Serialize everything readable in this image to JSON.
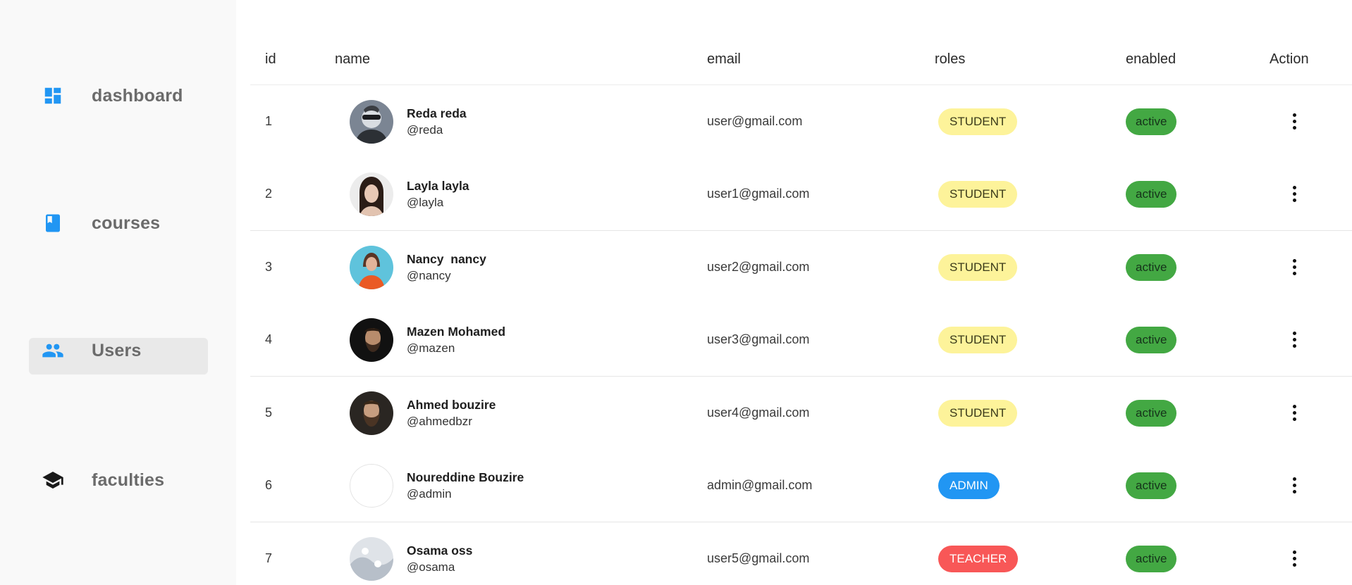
{
  "sidebar": {
    "items": [
      {
        "label": "dashboard",
        "icon": "dashboard-icon",
        "active": false
      },
      {
        "label": "courses",
        "icon": "book-icon",
        "active": false
      },
      {
        "label": "Users",
        "icon": "people-icon",
        "active": true
      },
      {
        "label": "faculties",
        "icon": "graduation-cap-icon",
        "active": false
      }
    ]
  },
  "table": {
    "headers": {
      "id": "id",
      "name": "name",
      "email": "email",
      "roles": "roles",
      "enabled": "enabled",
      "action": "Action"
    },
    "rows": [
      {
        "id": "1",
        "full_name": "Reda reda",
        "handle": "@reda",
        "email": "user@gmail.com",
        "role": "STUDENT",
        "status": "active",
        "avatar": "avatar-sunglasses-man"
      },
      {
        "id": "2",
        "full_name": "Layla layla",
        "handle": "@layla",
        "email": "user1@gmail.com",
        "role": "STUDENT",
        "status": "active",
        "avatar": "avatar-woman-dark-hair"
      },
      {
        "id": "3",
        "full_name": "Nancy  nancy",
        "handle": "@nancy",
        "email": "user2@gmail.com",
        "role": "STUDENT",
        "status": "active",
        "avatar": "avatar-woman-orange-shirt"
      },
      {
        "id": "4",
        "full_name": "Mazen Mohamed",
        "handle": "@mazen",
        "email": "user3@gmail.com",
        "role": "STUDENT",
        "status": "active",
        "avatar": "avatar-bearded-man"
      },
      {
        "id": "5",
        "full_name": "Ahmed bouzire",
        "handle": "@ahmedbzr",
        "email": "user4@gmail.com",
        "role": "STUDENT",
        "status": "active",
        "avatar": "avatar-bearded-man-2"
      },
      {
        "id": "6",
        "full_name": "Noureddine Bouzire",
        "handle": "@admin",
        "email": "admin@gmail.com",
        "role": "ADMIN",
        "status": "active",
        "avatar": "avatar-blank"
      },
      {
        "id": "7",
        "full_name": "Osama oss",
        "handle": "@osama",
        "email": "user5@gmail.com",
        "role": "TEACHER",
        "status": "active",
        "avatar": "avatar-placeholder"
      }
    ]
  },
  "colors": {
    "accent": "#2196f3",
    "student": "#fdf39a",
    "admin": "#2196f3",
    "teacher": "#f85757",
    "active": "#43a843"
  }
}
